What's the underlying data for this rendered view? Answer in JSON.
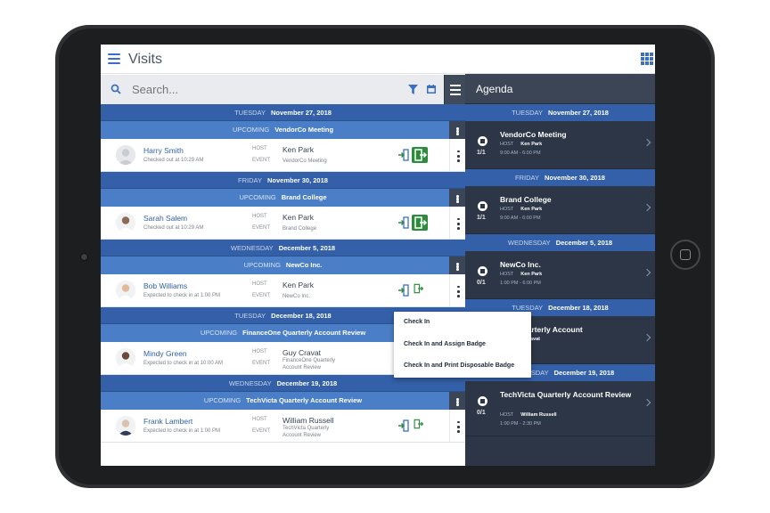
{
  "app": {
    "title": "Visits",
    "search_placeholder": "Search..."
  },
  "list": {
    "groups": [
      {
        "weekday": "TUESDAY",
        "date": "November 27, 2018",
        "status": "UPCOMING",
        "event": "VendorCo Meeting",
        "visit": {
          "name": "Harry Smith",
          "sub": "Checked out at 10:29 AM",
          "host": "Ken Park",
          "event": "VendorCo Meeting"
        }
      },
      {
        "weekday": "FRIDAY",
        "date": "November 30, 2018",
        "status": "UPCOMING",
        "event": "Brand College",
        "visit": {
          "name": "Sarah Salem",
          "sub": "Checked out at 10:29 AM",
          "host": "Ken Park",
          "event": "Brand College"
        }
      },
      {
        "weekday": "WEDNESDAY",
        "date": "December 5, 2018",
        "status": "UPCOMING",
        "event": "NewCo Inc.",
        "visit": {
          "name": "Bob Williams",
          "sub": "Expected to check in at 1:00 PM",
          "host": "Ken Park",
          "event": "NewCo Inc."
        }
      },
      {
        "weekday": "TUESDAY",
        "date": "December 18, 2018",
        "status": "UPCOMING",
        "event": "FinanceOne Quarterly Account Review",
        "visit": {
          "name": "Mindy Green",
          "sub": "Expected to check in at 10:00 AM",
          "host": "Guy Cravat",
          "event": "FinanceOne Quarterly Account Review"
        }
      },
      {
        "weekday": "WEDNESDAY",
        "date": "December 19, 2018",
        "status": "UPCOMING",
        "event": "TechVicta Quarterly Account Review",
        "visit": {
          "name": "Frank Lambert",
          "sub": "Expected to check in at 1:00 PM",
          "host": "William Russell",
          "event": "TechVicta Quarterly Account Review"
        }
      }
    ],
    "host_label": "HOST",
    "event_label": "EVENT"
  },
  "agenda": {
    "title": "Agenda",
    "host_label": "HOST",
    "items": [
      {
        "weekday": "TUESDAY",
        "date": "November 27, 2018",
        "name": "VendorCo Meeting",
        "host": "Ken Park",
        "time": "9:00 AM - 6:00 PM",
        "count": "1/1"
      },
      {
        "weekday": "FRIDAY",
        "date": "November 30, 2018",
        "name": "Brand College",
        "host": "Ken Park",
        "time": "9:00 AM - 6:00 PM",
        "count": "1/1"
      },
      {
        "weekday": "WEDNESDAY",
        "date": "December 5, 2018",
        "name": "NewCo Inc.",
        "host": "Ken Park",
        "time": "1:00 PM - 6:00 PM",
        "count": "0/1"
      },
      {
        "weekday": "TUESDAY",
        "date": "December 18, 2018",
        "name": "One Quarterly Account",
        "host": "y Cravat",
        "time": "AM",
        "count": ""
      },
      {
        "weekday": "WEDNESDAY",
        "date": "December 19, 2018",
        "name": "TechVicta Quarterly Account Review",
        "host": "William Russell",
        "time": "1:00 PM - 2:30 PM",
        "count": "0/1"
      }
    ]
  },
  "popup": {
    "items": [
      "Check In",
      "Check In and Assign Badge",
      "Check In and Print Disposable Badge"
    ]
  },
  "colors": {
    "date_header": "#3360a8",
    "event_header": "#4a7ec7",
    "agenda_bg": "#2d3646",
    "checkout_green": "#2e8b3e",
    "link_blue": "#2f5fa8"
  }
}
